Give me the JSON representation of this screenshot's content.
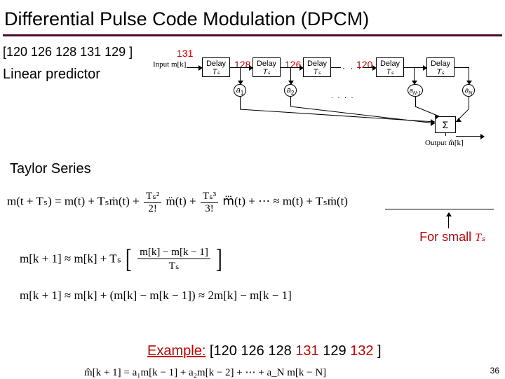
{
  "title": "Differential Pulse Code Modulation (DPCM)",
  "sequence_text": "[120 126 128 131 129 ]",
  "linear_predictor_label": "Linear predictor",
  "diagram": {
    "v131": "131",
    "v128": "128",
    "v126": "126",
    "v120": "120",
    "input_label": "Input m[k]",
    "delay_label": "Delay",
    "ts_label": "Tₛ",
    "a1": "a₁",
    "a2": "a₂",
    "aNm1": "a_{N-1}",
    "aN": "a_N",
    "dots": "· · ·",
    "sum": "Σ",
    "output_label": "Output m̂[k]",
    "dots2": ". . . ."
  },
  "taylor_label": "Taylor Series",
  "eq1_left": "m(t + Tₛ) = m(t) + Tₛṁ(t) + ",
  "eq1_f2n": "Tₛ²",
  "eq1_f2d": "2!",
  "eq1_mid1": " m̈(t) + ",
  "eq1_f3n": "Tₛ³",
  "eq1_f3d": "3!",
  "eq1_mid2": " m⃛(t) + ⋯ ≈ m(t) + Tₛṁ(t)",
  "eq2_left": "m[k + 1] ≈ m[k] + Tₛ",
  "eq2_fn": "m[k] − m[k − 1]",
  "eq2_fd": "Tₛ",
  "eq3": "m[k + 1] ≈ m[k] + (m[k] − m[k − 1]) ≈ 2m[k] − m[k − 1]",
  "for_small": "For small ",
  "for_small_ts": "Tₛ",
  "example_label": "Example:",
  "example_seq_pre": " [120 126 128 ",
  "example_seq_red": "131",
  "example_seq_post": " 129 ",
  "example_seq_red2": "132",
  "example_seq_end": " ]",
  "eq4": "m̂[k + 1] = a₁m[k − 1] + a₂m[k − 2] + ⋯ + a_N m[k − N]",
  "page_number": "36"
}
